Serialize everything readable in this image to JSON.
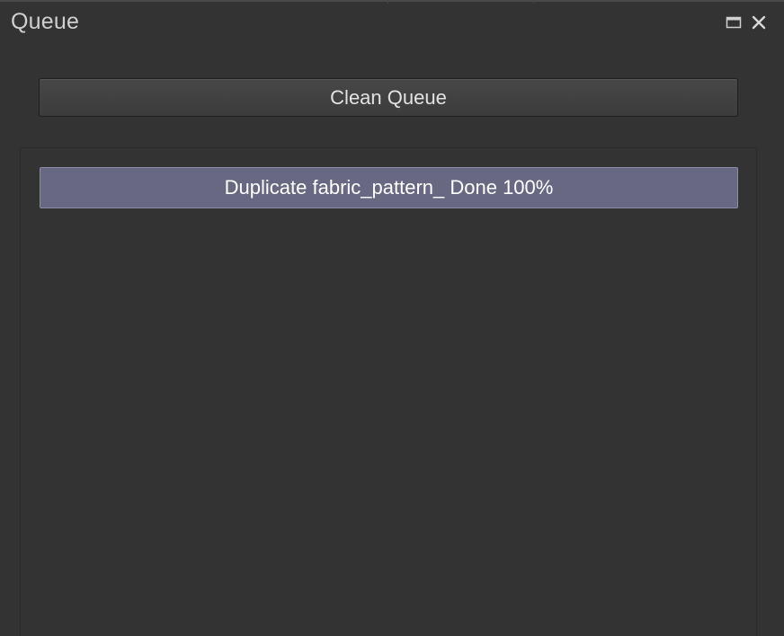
{
  "panel": {
    "title": "Queue",
    "maximize_icon": "maximize-icon",
    "close_icon": "close-icon"
  },
  "toolbar": {
    "clean_label": "Clean Queue"
  },
  "queue": {
    "items": [
      {
        "label": "Duplicate fabric_pattern_ Done 100%",
        "progress": 1.0
      }
    ]
  },
  "colors": {
    "background": "#333333",
    "item_fill": "#686883",
    "item_border": "#8c8ca8",
    "button_fill": "#424242"
  }
}
